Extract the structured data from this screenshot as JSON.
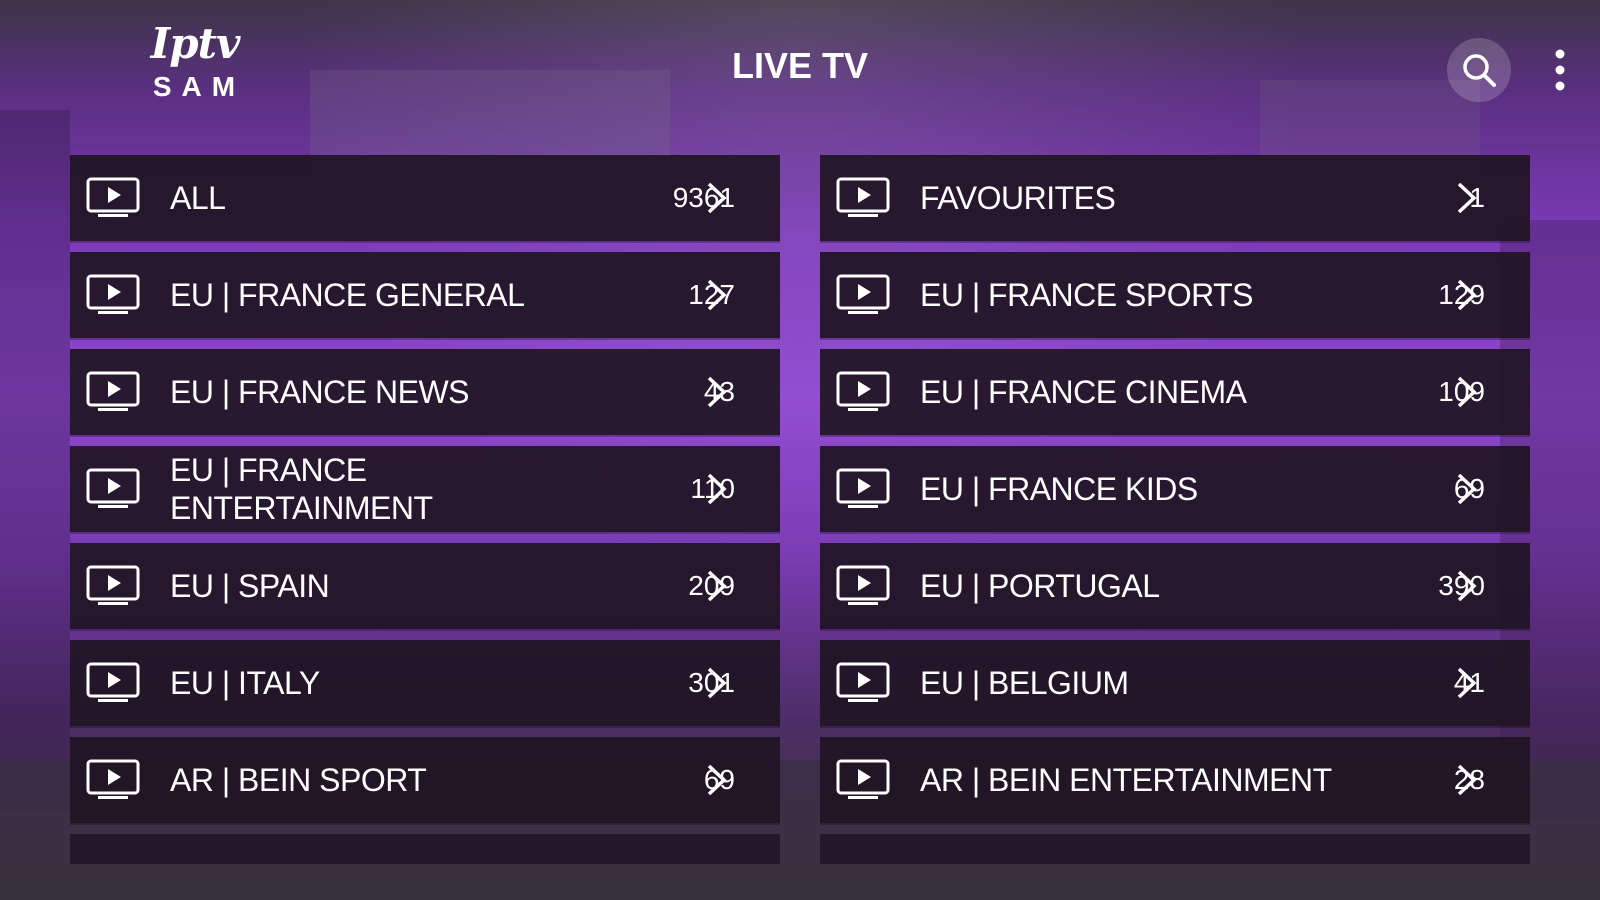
{
  "header": {
    "logo_script": "Iptv",
    "logo_word": "SAM",
    "title": "LIVE TV",
    "search_icon": "search-icon",
    "menu_icon": "more-vertical-icon"
  },
  "colors": {
    "row_background": "#201424",
    "accent_purple": "#8e47cf",
    "text": "#ffffff"
  },
  "categories": {
    "left": [
      {
        "name": "ALL",
        "count": "9361",
        "icon": "tv-play-icon"
      },
      {
        "name": "EU | FRANCE GENERAL",
        "count": "127",
        "icon": "tv-play-icon"
      },
      {
        "name": "EU | FRANCE NEWS",
        "count": "43",
        "icon": "tv-play-icon"
      },
      {
        "name": "EU | FRANCE ENTERTAINMENT",
        "count": "110",
        "icon": "tv-play-icon"
      },
      {
        "name": "EU | SPAIN",
        "count": "209",
        "icon": "tv-play-icon"
      },
      {
        "name": "EU | ITALY",
        "count": "301",
        "icon": "tv-play-icon"
      },
      {
        "name": "AR | BEIN SPORT",
        "count": "69",
        "icon": "tv-play-icon"
      }
    ],
    "right": [
      {
        "name": "FAVOURITES",
        "count": "1",
        "icon": "tv-play-icon"
      },
      {
        "name": "EU | FRANCE SPORTS",
        "count": "129",
        "icon": "tv-play-icon"
      },
      {
        "name": "EU | FRANCE CINEMA",
        "count": "109",
        "icon": "tv-play-icon"
      },
      {
        "name": "EU | FRANCE KIDS",
        "count": "69",
        "icon": "tv-play-icon"
      },
      {
        "name": "EU | PORTUGAL",
        "count": "390",
        "icon": "tv-play-icon"
      },
      {
        "name": "EU | BELGIUM",
        "count": "41",
        "icon": "tv-play-icon"
      },
      {
        "name": "AR | BEIN ENTERTAINMENT",
        "count": "28",
        "icon": "tv-play-icon"
      }
    ]
  }
}
